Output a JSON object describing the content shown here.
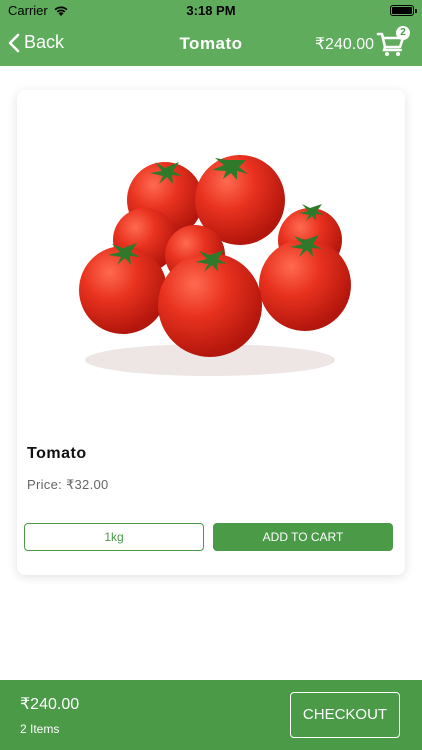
{
  "status_bar": {
    "carrier": "Carrier",
    "time": "3:18 PM"
  },
  "navbar": {
    "back_label": "Back",
    "title": "Tomato",
    "cart_total": "₹240.00",
    "cart_badge": "2",
    "back_icon": "chevron-left-icon",
    "cart_icon": "shopping-cart-icon"
  },
  "product": {
    "image": "tomato-bunch",
    "name": "Tomato",
    "price_label": "Price: ₹32.00",
    "quantity": "1kg",
    "add_to_cart_label": "ADD TO CART"
  },
  "footer": {
    "total": "₹240.00",
    "items_label": "2 Items",
    "checkout_label": "CHECKOUT"
  },
  "colors": {
    "accent": "#5eac5c",
    "accent_dark": "#4a9a48"
  }
}
